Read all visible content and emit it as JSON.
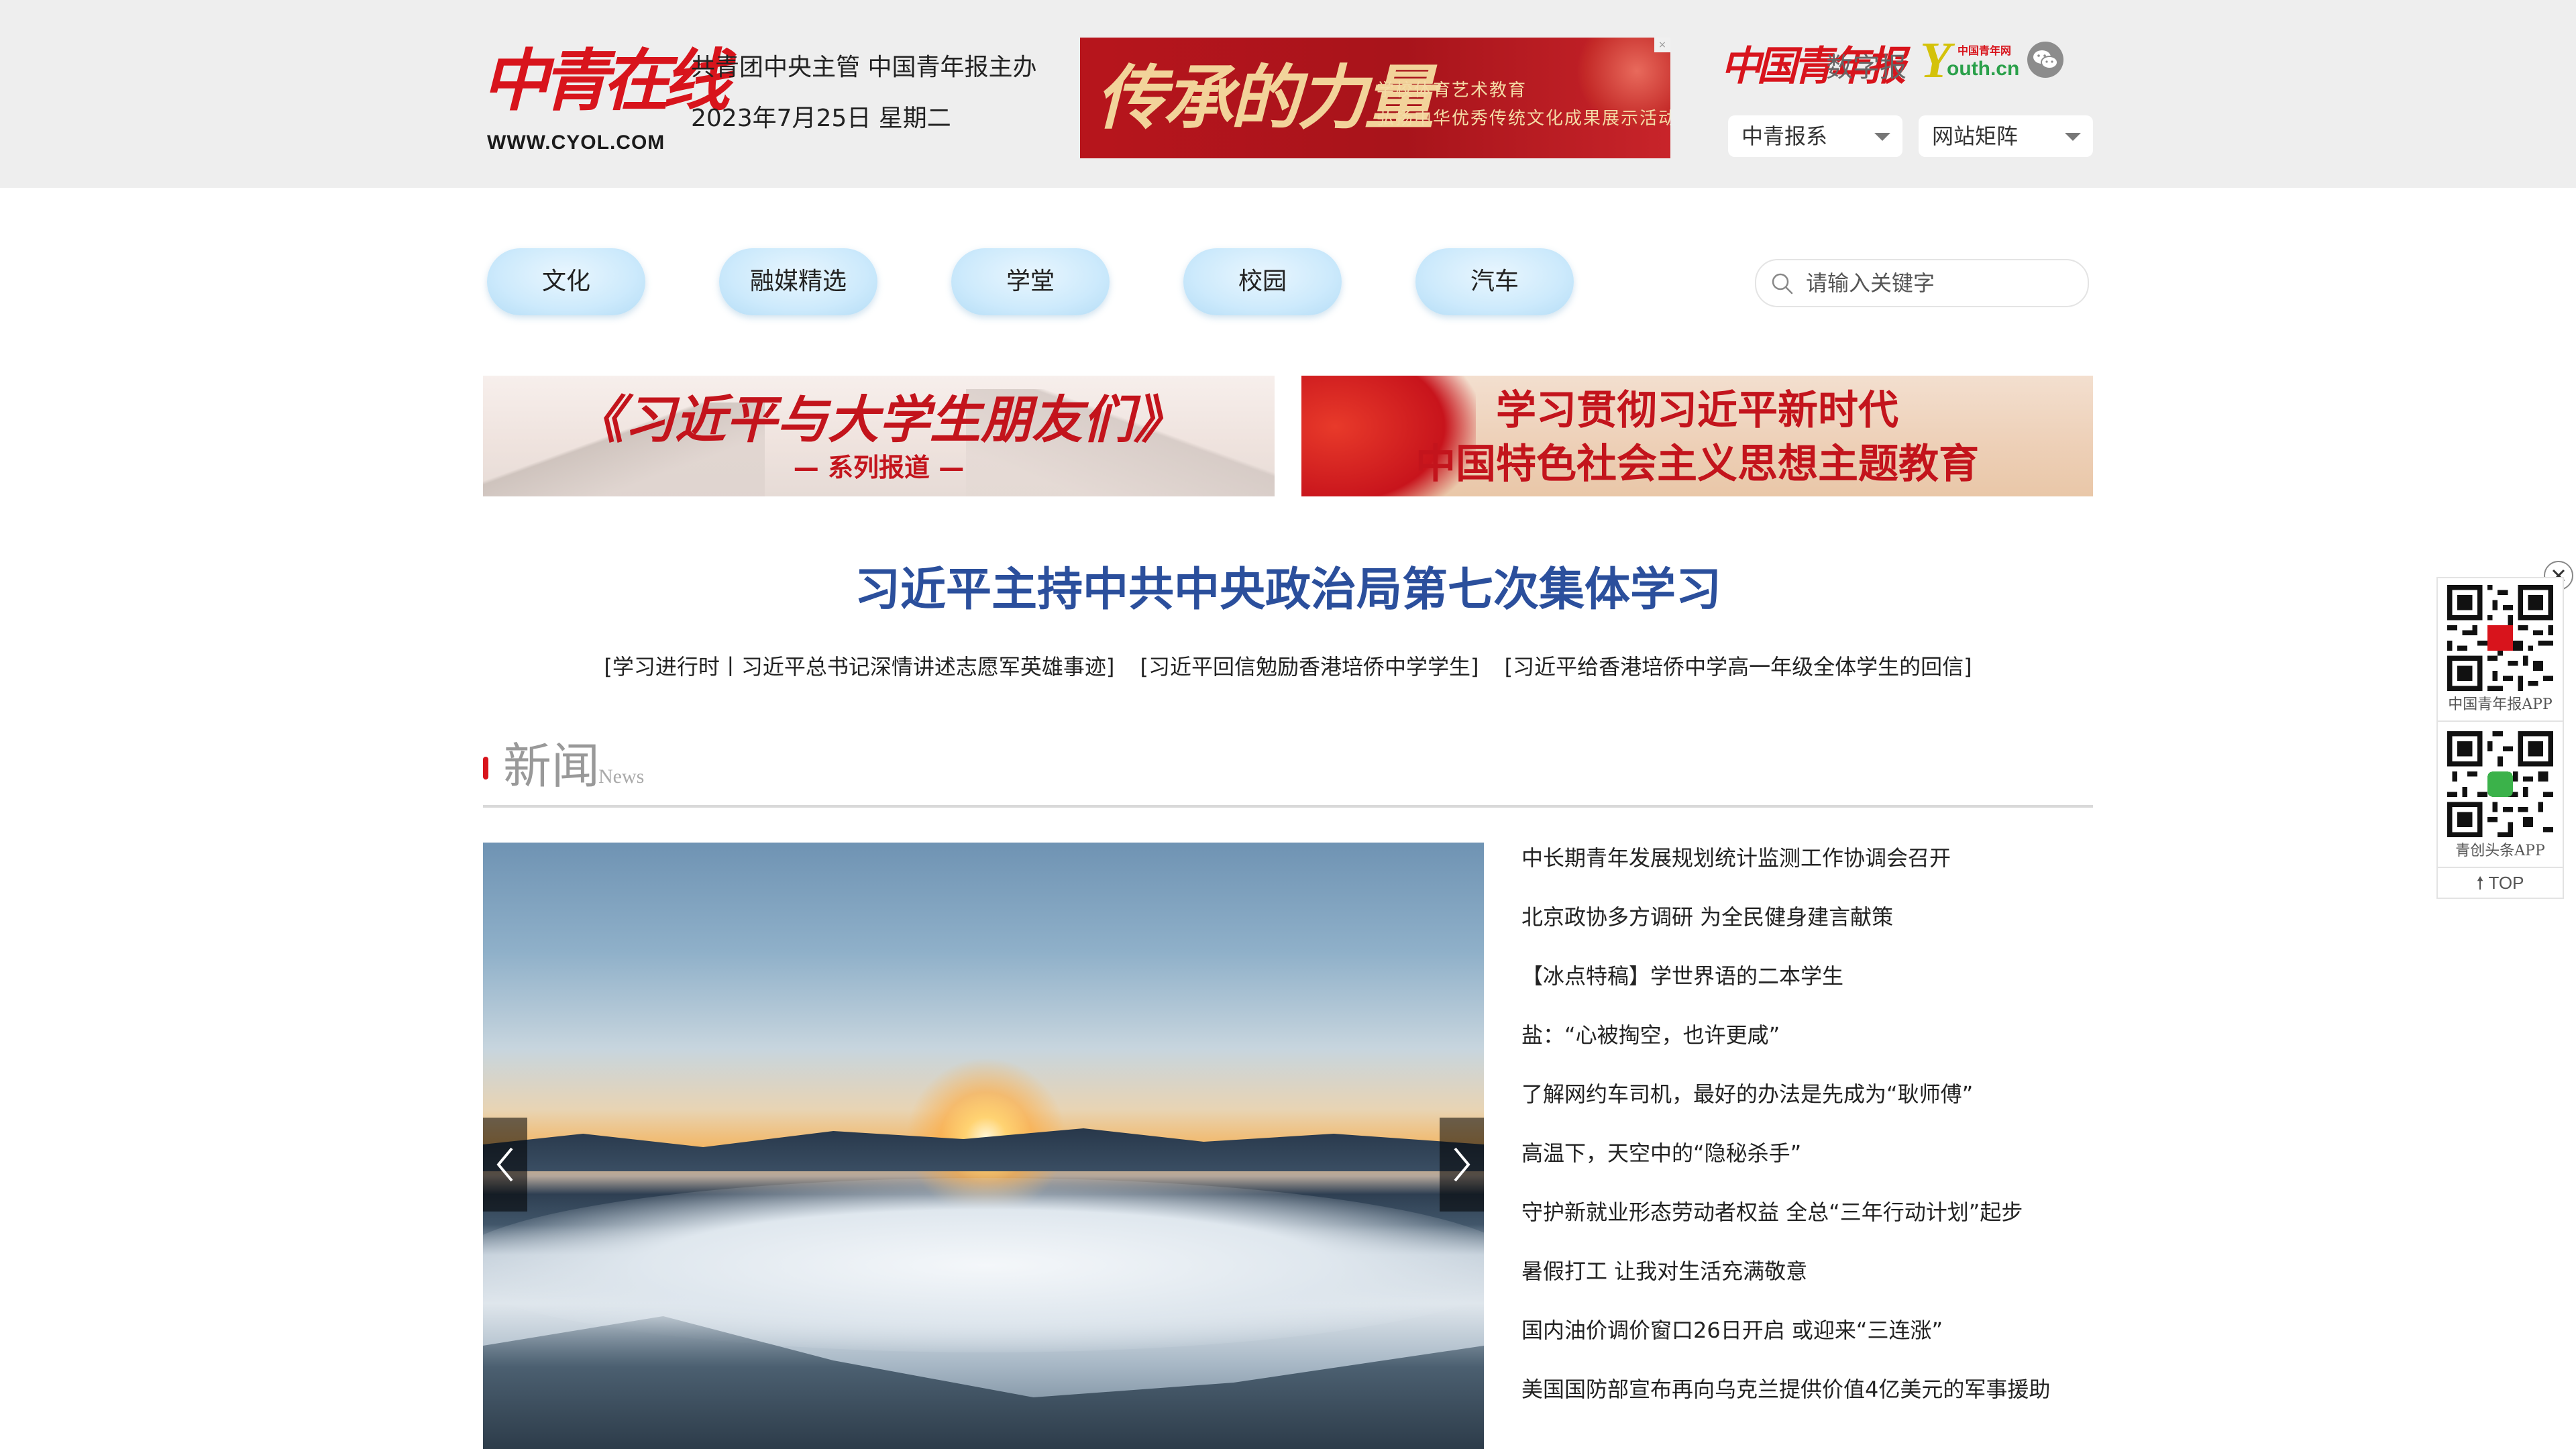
{
  "header": {
    "logo_text": "中青在线",
    "logo_url": "WWW.CYOL.COM",
    "sponsor": "共青团中央主管 中国青年报主办",
    "date": "2023年7月25日 星期二",
    "ad_banner": {
      "big_text": "传承的力量",
      "line1": "学校体育艺术教育",
      "line2": "弘扬中华优秀传统文化成果展示活动"
    },
    "cyd_logo": "中国青年报",
    "digital_label": "数字报",
    "youth_logo": {
      "y": "Y",
      "small": "中国青年网",
      "rest": "outh.cn"
    },
    "dropdowns": [
      "中青报系",
      "网站矩阵"
    ]
  },
  "nav": {
    "items": [
      "文化",
      "融媒精选",
      "学堂",
      "校园",
      "汽车"
    ],
    "search_placeholder": "请输入关键字"
  },
  "banners": {
    "left": {
      "title": "《习近平与大学生朋友们》",
      "subtitle": "— 系列报道 —"
    },
    "right": {
      "line1": "学习贯彻习近平新时代",
      "line2": "中国特色社会主义思想主题教育"
    }
  },
  "headline": {
    "title": "习近平主持中共中央政治局第七次集体学习",
    "links": [
      "[学习进行时丨习近平总书记深情讲述志愿军英雄事迹]",
      "[习近平回信勉励香港培侨中学学生]",
      "[习近平给香港培侨中学高一年级全体学生的回信]"
    ]
  },
  "news": {
    "title": "新闻",
    "subtitle": "News",
    "items": [
      "中长期青年发展规划统计监测工作协调会召开",
      "北京政协多方调研 为全民健身建言献策",
      "【冰点特稿】学世界语的二本学生",
      "盐：“心被掏空，也许更咸”",
      "了解网约车司机，最好的办法是先成为“耿师傅”",
      "高温下，天空中的“隐秘杀手”",
      "守护新就业形态劳动者权益 全总“三年行动计划”起步",
      "暑假打工 让我对生活充满敬意",
      "国内油价调价窗口26日开启 或迎来“三连涨”",
      "美国国防部宣布再向乌克兰提供价值4亿美元的军事援助"
    ]
  },
  "side_panel": {
    "app1": "中国青年报APP",
    "app2": "青创头条APP",
    "top": "TOP"
  },
  "colors": {
    "brand_red": "#d8141c",
    "headline_blue": "#2b4f9c",
    "nav_pill": "#cdeafc",
    "header_bg": "#eeeeee"
  }
}
